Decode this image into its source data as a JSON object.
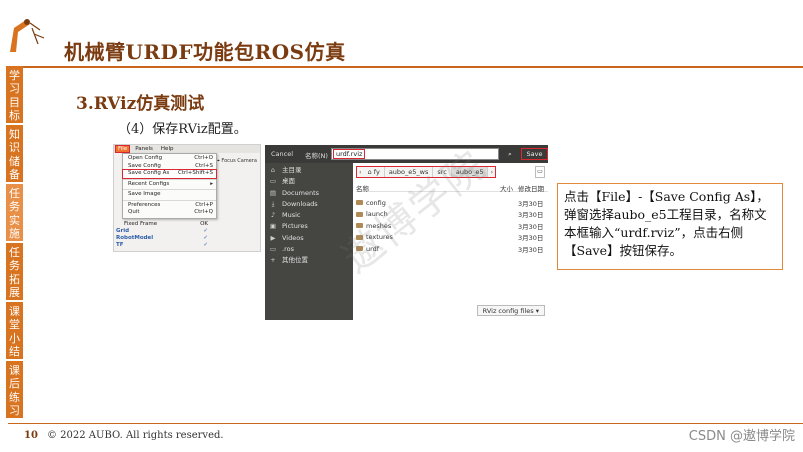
{
  "slide": {
    "title": "机械臂URDF功能包ROS仿真",
    "section": "3.RViz仿真测试",
    "step": "（4）保存RViz配置。",
    "page_number": "10",
    "copyright": "© 2022 AUBO. All rights reserved.",
    "csdn_mark": "CSDN @遨博学院",
    "watermark": "遨博学院"
  },
  "side_nav": [
    {
      "label": "学习目标"
    },
    {
      "label": "知识储备"
    },
    {
      "label": "任务实施"
    },
    {
      "label": "任务拓展"
    },
    {
      "label": "课堂小结"
    },
    {
      "label": "课后练习"
    }
  ],
  "rviz": {
    "menubar": [
      "File",
      "Panels",
      "Help"
    ],
    "toolbar_hint": "Focus Camera",
    "file_menu": [
      {
        "label": "Open Config",
        "shortcut": "Ctrl+O"
      },
      {
        "label": "Save Config",
        "shortcut": "Ctrl+S"
      },
      {
        "label": "Save Config As",
        "shortcut": "Ctrl+Shift+S"
      },
      {
        "label": "Recent Configs",
        "shortcut": "▸"
      },
      {
        "label": "Save Image",
        "shortcut": ""
      },
      {
        "label": "Preferences",
        "shortcut": "Ctrl+P"
      },
      {
        "label": "Quit",
        "shortcut": "Ctrl+Q"
      }
    ],
    "tree": [
      {
        "label": "Fixed Frame",
        "value": "OK"
      },
      {
        "label": "Grid",
        "value": "✓"
      },
      {
        "label": "RobotModel",
        "value": "✓"
      },
      {
        "label": "TF",
        "value": "✓"
      }
    ]
  },
  "dialog": {
    "cancel": "Cancel",
    "name_label": "名称(N)",
    "name_value": "urdf.rviz",
    "search_icon": "search-icon",
    "save": "Save",
    "places": [
      {
        "icon": "⌂",
        "label": "主目录"
      },
      {
        "icon": "▭",
        "label": "桌面"
      },
      {
        "icon": "▤",
        "label": "Documents"
      },
      {
        "icon": "⤓",
        "label": "Downloads"
      },
      {
        "icon": "♪",
        "label": "Music"
      },
      {
        "icon": "▣",
        "label": "Pictures"
      },
      {
        "icon": "▶",
        "label": "Videos"
      },
      {
        "icon": "▭",
        "label": ".ros"
      },
      {
        "icon": "+",
        "label": "其他位置"
      }
    ],
    "breadcrumbs": [
      "⌂ fy",
      "aubo_e5_ws",
      "src",
      "aubo_e5"
    ],
    "columns": {
      "name": "名称",
      "size": "大小",
      "modified": "修改日期"
    },
    "files": [
      {
        "name": "config",
        "date": "3月30日"
      },
      {
        "name": "launch",
        "date": "3月30日"
      },
      {
        "name": "meshes",
        "date": "3月30日"
      },
      {
        "name": "textures",
        "date": "3月30日"
      },
      {
        "name": "urdf",
        "date": "3月30日"
      }
    ],
    "filter": "RViz config files ▾"
  },
  "note": {
    "text": "点击【File】-【Save Config As】，弹窗选择aubo_e5工程目录，名称文本框输入“urdf.rviz”，点击右侧【Save】按钮保存。"
  },
  "colors": {
    "accent_orange": "#d8731f",
    "title_brown": "#7a3b10",
    "highlight_red": "#d9282f"
  }
}
